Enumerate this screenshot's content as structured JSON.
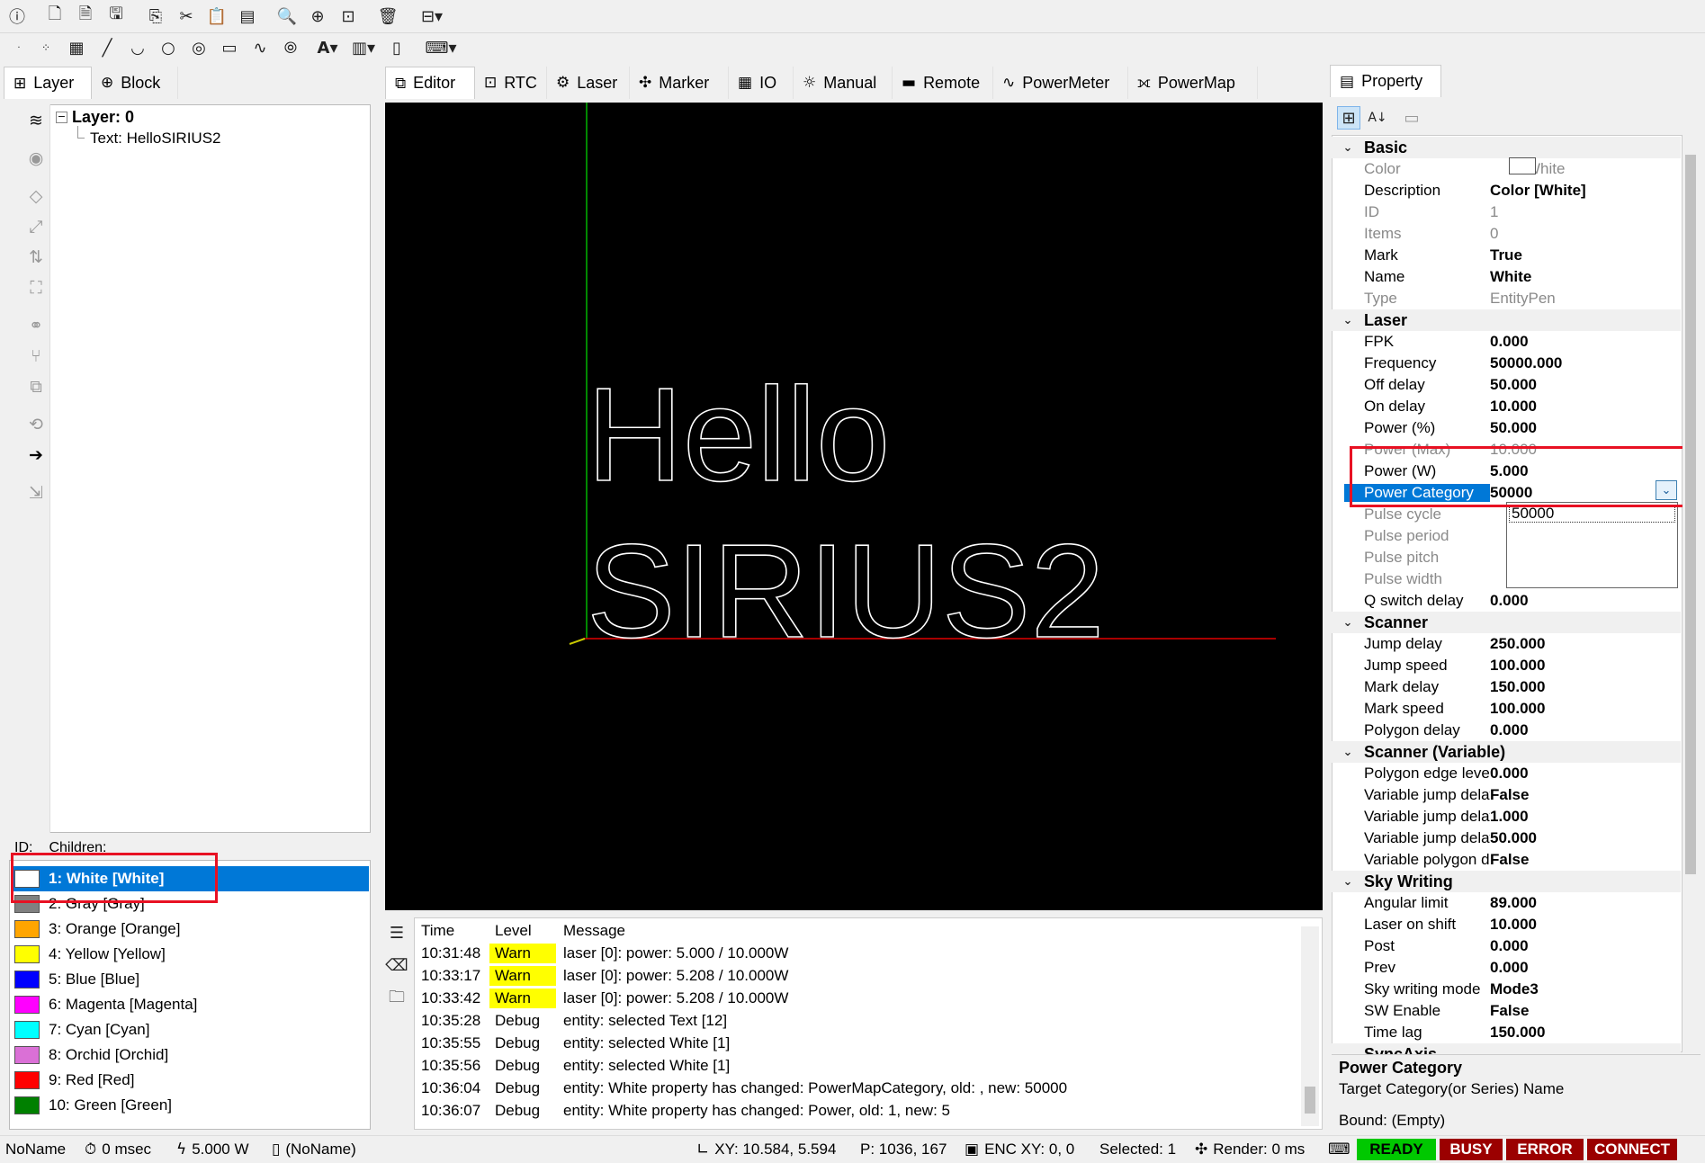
{
  "toolbar1": {
    "icons": [
      "info-icon",
      "new-document-icon",
      "new-file-icon",
      "save-icon",
      "copy-icon",
      "cut-icon",
      "paste-icon",
      "paste-array-icon",
      "zoom-out-icon",
      "zoom-in-icon",
      "zoom-fit-icon",
      "delete-icon",
      "align-icon"
    ]
  },
  "toolbar2": {
    "icons": [
      "point-icon",
      "points-icon",
      "raster-icon",
      "line-icon",
      "arc-icon",
      "circle-icon",
      "spiral-icon",
      "rectangle-icon",
      "curve-icon",
      "trepan-icon",
      "text-icon",
      "barcode-icon",
      "document-icon",
      "command-icon"
    ]
  },
  "left_tabs": [
    {
      "label": "Layer"
    },
    {
      "label": "Block"
    }
  ],
  "tree": {
    "layer": "Layer: 0",
    "child": "Text: HelloSIRIUS2"
  },
  "pen_header": {
    "id": "ID:",
    "children": "Children:"
  },
  "pens": [
    {
      "label": "1: White [White]",
      "color": "#ffffff"
    },
    {
      "label": "2: Gray [Gray]",
      "color": "#808080"
    },
    {
      "label": "3: Orange [Orange]",
      "color": "#ffa500"
    },
    {
      "label": "4: Yellow [Yellow]",
      "color": "#ffff00"
    },
    {
      "label": "5: Blue [Blue]",
      "color": "#0000ff"
    },
    {
      "label": "6: Magenta [Magenta]",
      "color": "#ff00ff"
    },
    {
      "label": "7: Cyan [Cyan]",
      "color": "#00ffff"
    },
    {
      "label": "8: Orchid [Orchid]",
      "color": "#da70d6"
    },
    {
      "label": "9: Red [Red]",
      "color": "#ff0000"
    },
    {
      "label": "10: Green [Green]",
      "color": "#008000"
    }
  ],
  "center_tabs": [
    {
      "label": "Editor"
    },
    {
      "label": "RTC"
    },
    {
      "label": "Laser"
    },
    {
      "label": "Marker"
    },
    {
      "label": "IO"
    },
    {
      "label": "Manual"
    },
    {
      "label": "Remote"
    },
    {
      "label": "PowerMeter"
    },
    {
      "label": "PowerMap"
    }
  ],
  "canvas": {
    "text_line1": "Hello",
    "text_line2": "SIRIUS2"
  },
  "log": {
    "headers": {
      "time": "Time",
      "level": "Level",
      "message": "Message"
    },
    "rows": [
      {
        "time": "10:31:48",
        "level": "Warn",
        "message": "laser [0]: power: 5.000 / 10.000W"
      },
      {
        "time": "10:33:17",
        "level": "Warn",
        "message": "laser [0]: power: 5.208 / 10.000W"
      },
      {
        "time": "10:33:42",
        "level": "Warn",
        "message": "laser [0]: power: 5.208 / 10.000W"
      },
      {
        "time": "10:35:28",
        "level": "Debug",
        "message": "entity: selected Text [12]"
      },
      {
        "time": "10:35:55",
        "level": "Debug",
        "message": "entity: selected White [1]"
      },
      {
        "time": "10:35:56",
        "level": "Debug",
        "message": "entity: selected White [1]"
      },
      {
        "time": "10:36:04",
        "level": "Debug",
        "message": "entity: White property has changed: PowerMapCategory, old: , new: 50000"
      },
      {
        "time": "10:36:07",
        "level": "Debug",
        "message": "entity: White property has changed: Power, old: 1, new: 5"
      }
    ]
  },
  "property": {
    "title": "Property",
    "categories": {
      "basic": "Basic",
      "laser": "Laser",
      "scanner": "Scanner",
      "scanner_var": "Scanner (Variable)",
      "sky": "Sky Writing",
      "sync": "SyncAxis"
    },
    "basic": [
      {
        "k": "Color",
        "v": "White"
      },
      {
        "k": "Description",
        "v": "Color [White]"
      },
      {
        "k": "ID",
        "v": "1"
      },
      {
        "k": "Items",
        "v": "0"
      },
      {
        "k": "Mark",
        "v": "True"
      },
      {
        "k": "Name",
        "v": "White"
      },
      {
        "k": "Type",
        "v": "EntityPen"
      }
    ],
    "laser": [
      {
        "k": "FPK",
        "v": "0.000"
      },
      {
        "k": "Frequency",
        "v": "50000.000"
      },
      {
        "k": "Off delay",
        "v": "50.000"
      },
      {
        "k": "On delay",
        "v": "10.000"
      },
      {
        "k": "Power (%)",
        "v": "50.000"
      },
      {
        "k": "Power (Max)",
        "v": "10.000"
      },
      {
        "k": "Power (W)",
        "v": "5.000"
      },
      {
        "k": "Power Category",
        "v": "50000"
      },
      {
        "k": "Pulse cycle",
        "v": ""
      },
      {
        "k": "Pulse period",
        "v": ""
      },
      {
        "k": "Pulse pitch",
        "v": ""
      },
      {
        "k": "Pulse width",
        "v": ""
      },
      {
        "k": "Q switch delay",
        "v": "0.000"
      }
    ],
    "dropdown_option": "50000",
    "scanner": [
      {
        "k": "Jump delay",
        "v": "250.000"
      },
      {
        "k": "Jump speed",
        "v": "100.000"
      },
      {
        "k": "Mark delay",
        "v": "150.000"
      },
      {
        "k": "Mark speed",
        "v": "100.000"
      },
      {
        "k": "Polygon delay",
        "v": "0.000"
      }
    ],
    "scanner_var": [
      {
        "k": "Polygon edge level",
        "v": "0.000"
      },
      {
        "k": "Variable jump delay",
        "v": "False"
      },
      {
        "k": "Variable jump delay",
        "v": "1.000"
      },
      {
        "k": "Variable jump delay",
        "v": "50.000"
      },
      {
        "k": "Variable polygon de",
        "v": "False"
      }
    ],
    "sky": [
      {
        "k": "Angular limit",
        "v": "89.000"
      },
      {
        "k": "Laser on shift",
        "v": "10.000"
      },
      {
        "k": "Post",
        "v": "0.000"
      },
      {
        "k": "Prev",
        "v": "0.000"
      },
      {
        "k": "Sky writing mode",
        "v": "Mode3"
      },
      {
        "k": "SW Enable",
        "v": "False"
      },
      {
        "k": "Time lag",
        "v": "150.000"
      }
    ],
    "help_title": "Power Category",
    "help_desc": "Target Category(or Series) Name",
    "bound": "Bound: (Empty)"
  },
  "status": {
    "name": "NoName",
    "time": "0 msec",
    "power": "5.000 W",
    "doc": "(NoName)",
    "xy": "XY: 10.584, 5.594",
    "p": "P: 1036, 167",
    "enc": "ENC XY: 0, 0",
    "selected": "Selected: 1",
    "render": "Render: 0 ms",
    "ready": "READY",
    "busy": "BUSY",
    "error": "ERROR",
    "connect": "CONNECT"
  },
  "colors": {
    "selection": "#0078d7",
    "ready": "#00c800",
    "status_red": "#9b0000",
    "highlight": "#e81123"
  }
}
